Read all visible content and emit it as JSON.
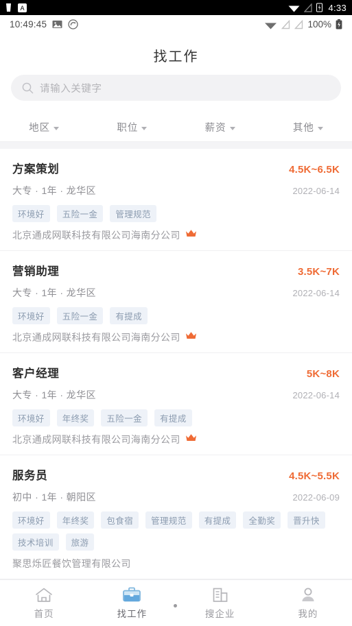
{
  "system_status_bar": {
    "icons_left": [
      "bookmark-icon",
      "letter-a-icon"
    ],
    "icons_right": [
      "wifi-icon",
      "signal-icon",
      "battery-icon"
    ],
    "time": "4:33"
  },
  "app_status_bar": {
    "time": "10:49:45",
    "icons_left": [
      "image-icon",
      "screenshot-icon"
    ],
    "icons_right": [
      "wifi-icon",
      "signal-icon-1",
      "signal-icon-2"
    ],
    "battery_percent": "100%",
    "battery_icon": "battery-icon"
  },
  "header": {
    "title": "找工作"
  },
  "search": {
    "icon": "search-icon",
    "placeholder": "请输入关键字",
    "value": ""
  },
  "filters": [
    {
      "label": "地区",
      "icon": "chevron-down-icon"
    },
    {
      "label": "职位",
      "icon": "chevron-down-icon"
    },
    {
      "label": "薪资",
      "icon": "chevron-down-icon"
    },
    {
      "label": "其他",
      "icon": "chevron-down-icon"
    }
  ],
  "colors": {
    "salary": "#ef6b35",
    "crown": "#ef6b35",
    "tag_bg": "#eef2f8",
    "tag_text": "#8c9cb0",
    "active_tab": "#5aa9e6",
    "page_bg": "#f4f4f6"
  },
  "jobs": [
    {
      "title": "方案策划",
      "salary": "4.5K~6.5K",
      "meta": "大专 · 1年 · 龙华区",
      "date": "2022-06-14",
      "tags": [
        "环境好",
        "五险一金",
        "管理规范"
      ],
      "company": "北京通成网联科技有限公司海南分公司",
      "vip": true,
      "vip_icon": "crown-icon"
    },
    {
      "title": "营销助理",
      "salary": "3.5K~7K",
      "meta": "大专 · 1年 · 龙华区",
      "date": "2022-06-14",
      "tags": [
        "环境好",
        "五险一金",
        "有提成"
      ],
      "company": "北京通成网联科技有限公司海南分公司",
      "vip": true,
      "vip_icon": "crown-icon"
    },
    {
      "title": "客户经理",
      "salary": "5K~8K",
      "meta": "大专 · 1年 · 龙华区",
      "date": "2022-06-14",
      "tags": [
        "环境好",
        "年终奖",
        "五险一金",
        "有提成"
      ],
      "company": "北京通成网联科技有限公司海南分公司",
      "vip": true,
      "vip_icon": "crown-icon"
    },
    {
      "title": "服务员",
      "salary": "4.5K~5.5K",
      "meta": "初中 · 1年 · 朝阳区",
      "date": "2022-06-09",
      "tags": [
        "环境好",
        "年终奖",
        "包食宿",
        "管理规范",
        "有提成",
        "全勤奖",
        "晋升快",
        "技术培训",
        "旅游"
      ],
      "company": "聚思烁匠餐饮管理有限公司",
      "vip": false,
      "vip_icon": ""
    }
  ],
  "tabbar": [
    {
      "label": "首页",
      "icon": "home-icon",
      "active": false
    },
    {
      "label": "找工作",
      "icon": "briefcase-icon",
      "active": true
    },
    {
      "label": "搜企业",
      "icon": "building-icon",
      "active": false
    },
    {
      "label": "我的",
      "icon": "person-icon",
      "active": false
    }
  ]
}
